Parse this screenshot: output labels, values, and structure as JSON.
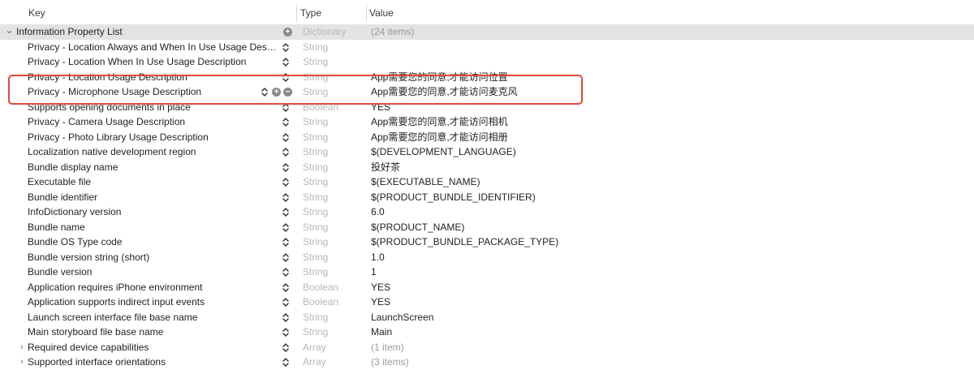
{
  "header": {
    "key": "Key",
    "type": "Type",
    "value": "Value"
  },
  "rows": [
    {
      "key": "Information Property List",
      "type": "Dictionary",
      "value": "(24 items)",
      "root": true,
      "disclosure": "down",
      "value_dim": true
    },
    {
      "key": "Privacy - Location Always and When In Use Usage Des…",
      "type": "String",
      "value": ""
    },
    {
      "key": "Privacy - Location When In Use Usage Description",
      "type": "String",
      "value": ""
    },
    {
      "key": "Privacy - Location Usage Description",
      "type": "String",
      "value": "App需要您的同意,才能访问位置"
    },
    {
      "key": "Privacy - Microphone Usage Description",
      "type": "String",
      "value": "App需要您的同意,才能访问麦克风",
      "selected": true
    },
    {
      "key": "Supports opening documents in place",
      "type": "Boolean",
      "value": "YES"
    },
    {
      "key": "Privacy - Camera Usage Description",
      "type": "String",
      "value": "App需要您的同意,才能访问相机"
    },
    {
      "key": "Privacy - Photo Library Usage Description",
      "type": "String",
      "value": "App需要您的同意,才能访问相册"
    },
    {
      "key": "Localization native development region",
      "type": "String",
      "value": "$(DEVELOPMENT_LANGUAGE)"
    },
    {
      "key": "Bundle display name",
      "type": "String",
      "value": "投好茶"
    },
    {
      "key": "Executable file",
      "type": "String",
      "value": "$(EXECUTABLE_NAME)"
    },
    {
      "key": "Bundle identifier",
      "type": "String",
      "value": "$(PRODUCT_BUNDLE_IDENTIFIER)"
    },
    {
      "key": "InfoDictionary version",
      "type": "String",
      "value": "6.0"
    },
    {
      "key": "Bundle name",
      "type": "String",
      "value": "$(PRODUCT_NAME)"
    },
    {
      "key": "Bundle OS Type code",
      "type": "String",
      "value": "$(PRODUCT_BUNDLE_PACKAGE_TYPE)"
    },
    {
      "key": "Bundle version string (short)",
      "type": "String",
      "value": "1.0"
    },
    {
      "key": "Bundle version",
      "type": "String",
      "value": "1"
    },
    {
      "key": "Application requires iPhone environment",
      "type": "Boolean",
      "value": "YES"
    },
    {
      "key": "Application supports indirect input events",
      "type": "Boolean",
      "value": "YES"
    },
    {
      "key": "Launch screen interface file base name",
      "type": "String",
      "value": "LaunchScreen"
    },
    {
      "key": "Main storyboard file base name",
      "type": "String",
      "value": "Main"
    },
    {
      "key": "Required device capabilities",
      "type": "Array",
      "value": "(1 item)",
      "disclosure": "right",
      "value_dim": true
    },
    {
      "key": "Supported interface orientations",
      "type": "Array",
      "value": "(3 items)",
      "disclosure": "right",
      "value_dim": true
    }
  ],
  "colors": {
    "highlight": "#e04a3a",
    "root_row": "#e3e3e6",
    "type_text": "#b8b8b8"
  },
  "icons": {
    "stepper": "updown-chevron-icon",
    "add": "plus-circle-icon",
    "remove": "minus-circle-icon",
    "expanded": "chevron-down-icon",
    "collapsed": "chevron-right-icon"
  }
}
